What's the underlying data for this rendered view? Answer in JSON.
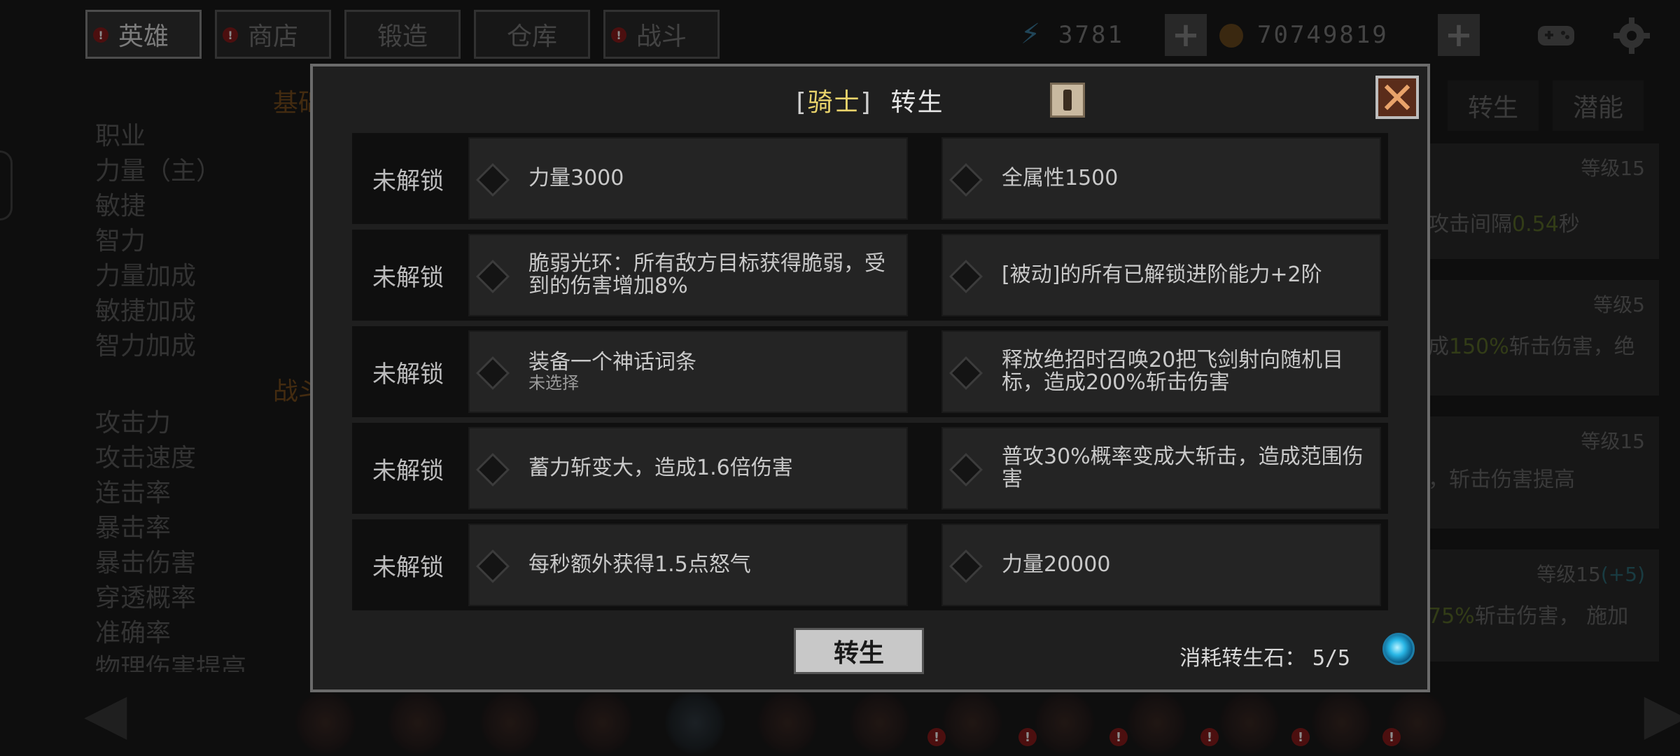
{
  "topbar": {
    "tabs": [
      {
        "label": "英雄",
        "alert": true,
        "active": true
      },
      {
        "label": "商店",
        "alert": true,
        "active": false
      },
      {
        "label": "锻造",
        "alert": false,
        "active": false
      },
      {
        "label": "仓库",
        "alert": false,
        "active": false
      },
      {
        "label": "战斗",
        "alert": true,
        "active": false
      }
    ],
    "alert_mark": "!",
    "energy": "3781",
    "gold": "70749819",
    "plus": "+",
    "icons": [
      "lightning-icon",
      "coin-icon",
      "gamepad-icon",
      "gear-icon"
    ]
  },
  "background": {
    "section_basic": "基础",
    "section_combat": "战斗",
    "stats_basic": [
      "职业",
      "力量（主）",
      "敏捷",
      "智力",
      "力量加成",
      "敏捷加成",
      "智力加成"
    ],
    "stats_combat": [
      "攻击力",
      "攻击速度",
      "连击率",
      "暴击率",
      "暴击伤害",
      "穿透概率",
      "准确率",
      "物理伤害提高"
    ],
    "right_tabs": [
      "转生",
      "潜能"
    ],
    "right_cards": [
      {
        "level": "等级15",
        "text_a": "攻击间隔",
        "text_b": "0.54",
        "text_c": "秒"
      },
      {
        "level": "等级5",
        "text_a": "成",
        "text_b": "150%",
        "text_c": "斩击伤害，绝"
      },
      {
        "level": "等级15",
        "text_a": "，斩击伤害提高",
        "text_b": "",
        "text_c": ""
      },
      {
        "level": "等级15",
        "level_bonus": "(+5)",
        "text_a": "",
        "text_b": "75%",
        "text_c": "斩击伤害， 施加"
      }
    ],
    "nav_prev": "◀",
    "nav_next": "▶"
  },
  "modal": {
    "bracket_open": "[",
    "class_name": "骑士",
    "bracket_close": "]",
    "title": "转生",
    "rows": [
      {
        "status": "未解锁",
        "left": {
          "text": "力量3000",
          "sub": ""
        },
        "right": {
          "text": "全属性1500",
          "sub": ""
        }
      },
      {
        "status": "未解锁",
        "left": {
          "text": "脆弱光环：所有敌方目标获得脆弱，受到的伤害增加8%",
          "sub": ""
        },
        "right": {
          "text": "[被动]的所有已解锁进阶能力+2阶",
          "sub": ""
        }
      },
      {
        "status": "未解锁",
        "left": {
          "text": "装备一个神话词条",
          "sub": "未选择"
        },
        "right": {
          "text": "释放绝招时召唤20把飞剑射向随机目标，造成200%斩击伤害",
          "sub": ""
        }
      },
      {
        "status": "未解锁",
        "left": {
          "text": "蓄力斩变大，造成1.6倍伤害",
          "sub": ""
        },
        "right": {
          "text": "普攻30%概率变成大斩击，造成范围伤害",
          "sub": ""
        }
      },
      {
        "status": "未解锁",
        "left": {
          "text": "每秒额外获得1.5点怒气",
          "sub": ""
        },
        "right": {
          "text": "力量20000",
          "sub": ""
        }
      }
    ],
    "rebirth_button": "转生",
    "cost_label": "消耗转生石：",
    "cost_value": "5/5"
  },
  "colors": {
    "class_name": "#e9d36b",
    "close_button": "#5a2c1a",
    "rebirth_button": "#c8c8c8",
    "alert": "#8b1d1d"
  }
}
